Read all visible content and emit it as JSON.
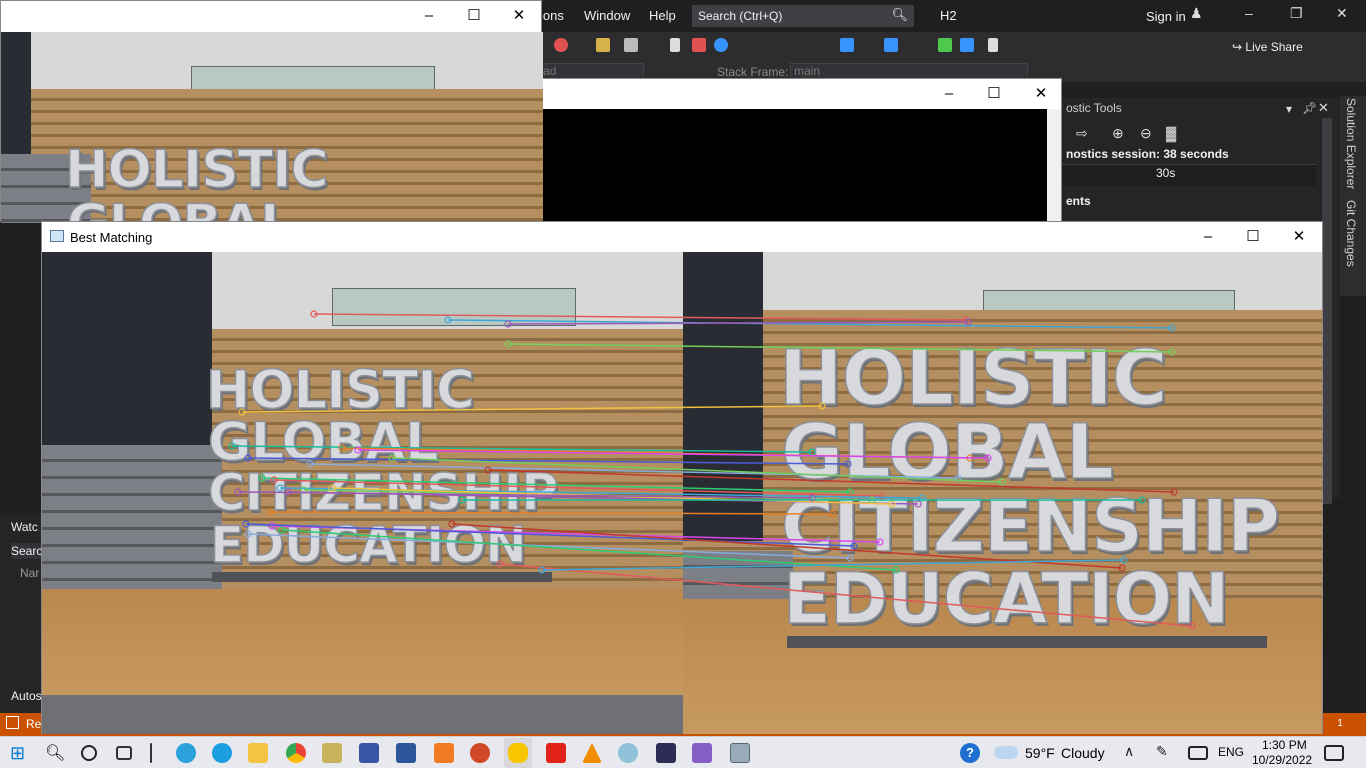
{
  "vs": {
    "menu": [
      "ions",
      "Window",
      "Help"
    ],
    "search_placeholder": "Search (Ctrl+Q)",
    "solution_name": "H2",
    "sign_in": "Sign in",
    "live_share": "Live Share",
    "process_value": "ad",
    "stack_frame_label": "Stack Frame:",
    "stack_frame_value": "main",
    "diagnostics": {
      "title": "ostic Tools",
      "session": "nostics session: 38 seconds",
      "tick": "30s",
      "events": "ents"
    },
    "side_tabs": [
      "Solution Explorer",
      "Git Changes"
    ],
    "watch": {
      "title": "Watc",
      "search": "Searc",
      "name_col": "Nar",
      "autos": "Autos"
    },
    "status": "Re",
    "notifications": "1",
    "accent": "#ca5100"
  },
  "windows": {
    "console_title": "",
    "best_matching_title": "Best Matching"
  },
  "scene": {
    "words": [
      "HOLISTIC",
      "GLOBAL",
      "CITIZENSHIP",
      "EDUCATION"
    ],
    "match_colors": [
      "#e05a5a",
      "#3fa7d6",
      "#9b59b6",
      "#6fcf5a",
      "#f0c040",
      "#1abc9c",
      "#e67e22",
      "#d946ef",
      "#4b5cd6",
      "#8ad",
      "#c0392b",
      "#2ecc71"
    ]
  },
  "taskbar": {
    "apps": [
      "windows-start",
      "search",
      "cortana",
      "task-view",
      "separator",
      "telegram",
      "edge",
      "file-explorer",
      "chrome",
      "tool",
      "visio",
      "word",
      "app-orange",
      "powerpoint",
      "messaging",
      "acrobat",
      "vlc",
      "app-colors",
      "cmd",
      "visual-studio",
      "image-viewer"
    ],
    "weather_temp": "59°F",
    "weather_cond": "Cloudy",
    "lang": "ENG",
    "time": "1:30 PM",
    "date": "10/29/2022"
  }
}
